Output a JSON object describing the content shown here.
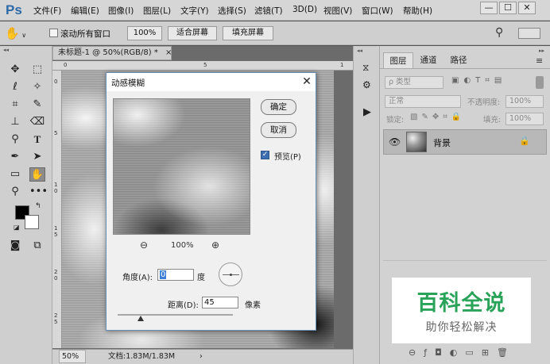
{
  "menubar": {
    "logo": "Ps",
    "items": [
      {
        "label": "文件(F)"
      },
      {
        "label": "编辑(E)"
      },
      {
        "label": "图像(I)"
      },
      {
        "label": "图层(L)"
      },
      {
        "label": "文字(Y)"
      },
      {
        "label": "选择(S)"
      },
      {
        "label": "滤镜(T)"
      },
      {
        "label": "3D(D)"
      },
      {
        "label": "视图(V)"
      },
      {
        "label": "窗口(W)"
      },
      {
        "label": "帮助(H)"
      }
    ],
    "window_controls": {
      "minimize": "—",
      "restore": "☐",
      "close": "✕"
    }
  },
  "optionsbar": {
    "scroll_all_windows": {
      "label": "滚动所有窗口",
      "checked": false
    },
    "buttons": [
      "100%",
      "适合屏幕",
      "填充屏幕"
    ]
  },
  "document": {
    "tab_title": "未标题-1 @ 50%(RGB/8) *",
    "tab_close": "×",
    "zoom": "50%",
    "doc_size": "文档:1.83M/1.83M",
    "ruler_top_marks": [
      "0",
      "5",
      "1"
    ],
    "ruler_left_marks": [
      "0",
      "5",
      "1 0",
      "1 5",
      "2 0",
      "2 5"
    ]
  },
  "layers_panel": {
    "tabs": [
      "图层",
      "通道",
      "路径"
    ],
    "active_tab": "图层",
    "filter_placeholder": "ρ 类型",
    "blend_mode": "正常",
    "opacity_label": "不透明度:",
    "opacity_value": "100%",
    "lock_label": "锁定:",
    "fill_label": "填充:",
    "fill_value": "100%",
    "layer": {
      "name": "背景",
      "locked": true,
      "visible": true
    }
  },
  "dialog": {
    "title": "动感模糊",
    "close": "✕",
    "ok_label": "确定",
    "cancel_label": "取消",
    "preview_label": "预览(P)",
    "preview_checked": true,
    "zoom_level": "100%",
    "angle_label": "角度(A):",
    "angle_value": "0",
    "angle_unit": "度",
    "distance_label": "距离(D):",
    "distance_value": "45",
    "distance_unit": "像素",
    "distance_slider_fraction": 0.2
  },
  "watermark": {
    "logo": "百科全说",
    "subtitle": "助你轻松解决"
  },
  "colors": {
    "accent": "#2d6aa8",
    "watermark_green": "#2aa35a",
    "foreground_swatch": "#000000",
    "background_swatch": "#ffffff"
  }
}
